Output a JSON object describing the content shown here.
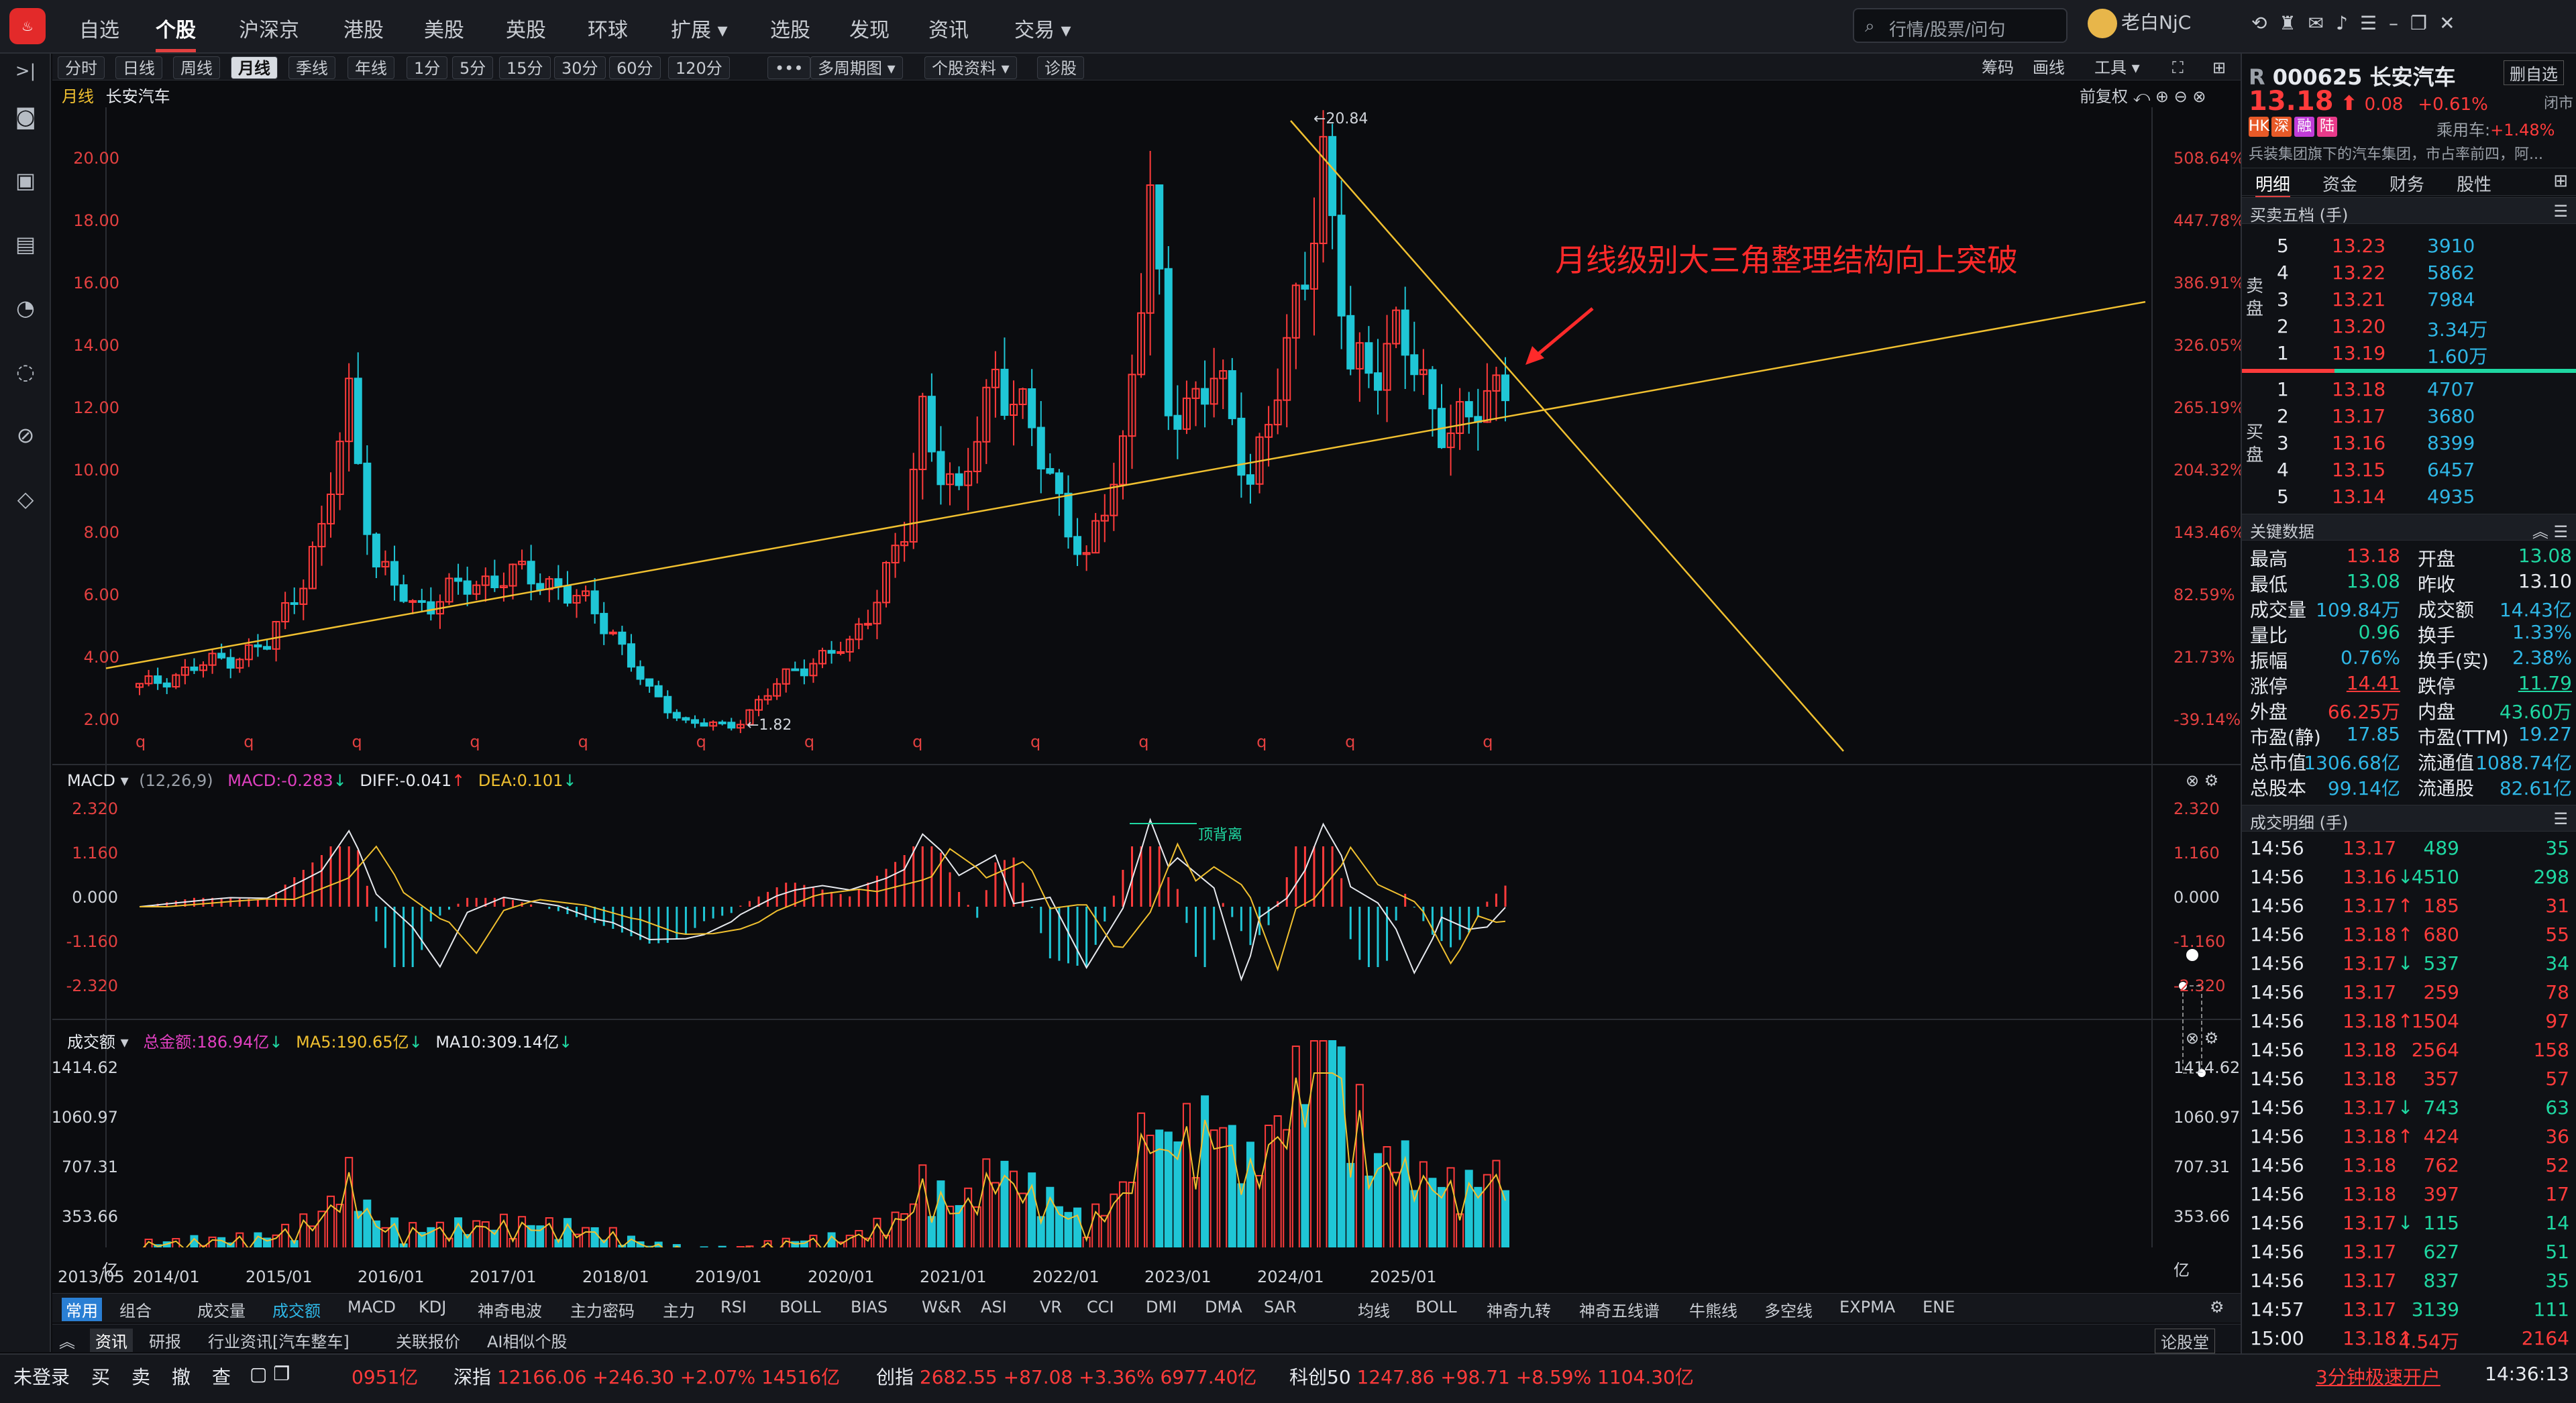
{
  "app": {
    "logo_text": "同花顺"
  },
  "nav": {
    "tabs": [
      "自选",
      "个股",
      "沪深京",
      "港股",
      "美股",
      "英股",
      "环球",
      "扩展",
      "选股",
      "发现",
      "资讯",
      "交易"
    ],
    "active": "个股",
    "search_placeholder": "行情/股票/问句",
    "user": "老白NjC"
  },
  "toolbar": {
    "periods": [
      "分时",
      "日线",
      "周线",
      "月线",
      "季线",
      "年线",
      "1分",
      "5分",
      "15分",
      "30分",
      "60分",
      "120分"
    ],
    "active_period": "月线",
    "more": "•••",
    "multi_cycle": "多周期图",
    "stock_info": "个股资料",
    "diagnose": "诊股",
    "right": [
      "筹码",
      "画线",
      "工具"
    ]
  },
  "chart_header": {
    "period": "月线",
    "name": "长安汽车",
    "restore": "前复权"
  },
  "annotation": "月线级别大三角整理结构向上突破",
  "price_marks": {
    "high": "←20.84",
    "low": "←1.82"
  },
  "macd_header": {
    "name": "MACD",
    "params": "(12,26,9)",
    "macd": "MACD:-0.283",
    "diff": "DIFF:-0.041",
    "dea": "DEA:0.101"
  },
  "macd_label": "顶背离",
  "vol_header": {
    "name": "成交额",
    "total": "总金额:186.94亿",
    "ma5": "MA5:190.65亿",
    "ma10": "MA10:309.14亿"
  },
  "x_axis": [
    "2013/05",
    "2014/01",
    "2015/01",
    "2016/01",
    "2017/01",
    "2018/01",
    "2019/01",
    "2020/01",
    "2021/01",
    "2022/01",
    "2023/01",
    "2024/01",
    "2025/01"
  ],
  "main_y_left": [
    "20.00",
    "18.00",
    "16.00",
    "14.00",
    "12.00",
    "10.00",
    "8.00",
    "6.00",
    "4.00",
    "2.00"
  ],
  "main_y_right": [
    "508.64%",
    "447.78%",
    "386.91%",
    "326.05%",
    "265.19%",
    "204.32%",
    "143.46%",
    "82.59%",
    "21.73%",
    "-39.14%"
  ],
  "macd_y": [
    "2.320",
    "1.160",
    "0.000",
    "-1.160",
    "-2.320"
  ],
  "vol_y": [
    "1414.62",
    "1060.97",
    "707.31",
    "353.66",
    "亿"
  ],
  "bottom_tabs": {
    "left": [
      "常用",
      "组合",
      "成交量",
      "成交额",
      "MACD",
      "KDJ",
      "神奇电波",
      "主力密码",
      "主力",
      "RSI",
      "BOLL",
      "BIAS",
      "W&R",
      "ASI",
      "VR",
      "CCI",
      "DMI",
      "DMA",
      "SAR"
    ],
    "active_left": [
      "常用",
      "成交额"
    ],
    "right": [
      "均线",
      "BOLL",
      "神奇九转",
      "神奇五线谱",
      "牛熊线",
      "多空线",
      "EXPMA",
      "ENE"
    ]
  },
  "info_tabs": [
    "资讯",
    "研报",
    "行业资讯[汽车整车]",
    "关联报价",
    "AI相似个股"
  ],
  "info_right": "论股堂",
  "stock": {
    "prefix": "R",
    "code": "000625",
    "name": "长安汽车",
    "price": "13.18",
    "change": "0.08",
    "pct": "+0.61%",
    "status": "闭市",
    "sector": "乘用车:",
    "sector_pct": "+1.48%",
    "desc": "兵装集团旗下的汽车集团，市占率前四，阿...",
    "tags": [
      "HK",
      "深",
      "融",
      "陆"
    ]
  },
  "panel_tabs": [
    "明细",
    "资金",
    "财务",
    "股性"
  ],
  "five_levels_title": "买卖五档 (手)",
  "sell_label": "卖盘",
  "buy_label": "买盘",
  "asks": [
    {
      "level": "5",
      "price": "13.23",
      "vol": "3910"
    },
    {
      "level": "4",
      "price": "13.22",
      "vol": "5862"
    },
    {
      "level": "3",
      "price": "13.21",
      "vol": "7984"
    },
    {
      "level": "2",
      "price": "13.20",
      "vol": "3.34万"
    },
    {
      "level": "1",
      "price": "13.19",
      "vol": "1.60万"
    }
  ],
  "bids": [
    {
      "level": "1",
      "price": "13.18",
      "vol": "4707"
    },
    {
      "level": "2",
      "price": "13.17",
      "vol": "3680"
    },
    {
      "level": "3",
      "price": "13.16",
      "vol": "8399"
    },
    {
      "level": "4",
      "price": "13.15",
      "vol": "6457"
    },
    {
      "level": "5",
      "price": "13.14",
      "vol": "4935"
    }
  ],
  "key_title": "关键数据",
  "key_data": [
    [
      "最高",
      "13.18",
      "red",
      "开盘",
      "13.08",
      "green"
    ],
    [
      "最低",
      "13.08",
      "green",
      "昨收",
      "13.10",
      "white"
    ],
    [
      "成交量",
      "109.84万",
      "cyan",
      "成交额",
      "14.43亿",
      "cyan"
    ],
    [
      "量比",
      "0.96",
      "green",
      "换手",
      "1.33%",
      "cyan"
    ],
    [
      "振幅",
      "0.76%",
      "cyan",
      "换手(实)",
      "2.38%",
      "cyan"
    ],
    [
      "涨停",
      "14.41",
      "red",
      "跌停",
      "11.79",
      "green"
    ],
    [
      "外盘",
      "66.25万",
      "red",
      "内盘",
      "43.60万",
      "green"
    ],
    [
      "市盈(静)",
      "17.85",
      "cyan",
      "市盈(TTM)",
      "19.27",
      "cyan"
    ],
    [
      "总市值",
      "1306.68亿",
      "cyan",
      "流通值",
      "1088.74亿",
      "cyan"
    ],
    [
      "总股本",
      "99.14亿",
      "cyan",
      "流通股",
      "82.61亿",
      "cyan"
    ]
  ],
  "trades_title": "成交明细 (手)",
  "trades": [
    [
      "14:56",
      "13.17",
      "",
      "489",
      "35",
      "green"
    ],
    [
      "14:56",
      "13.16",
      "↓",
      "4510",
      "298",
      "green"
    ],
    [
      "14:56",
      "13.17",
      "↑",
      "185",
      "31",
      "red"
    ],
    [
      "14:56",
      "13.18",
      "↑",
      "680",
      "55",
      "red"
    ],
    [
      "14:56",
      "13.17",
      "↓",
      "537",
      "34",
      "green"
    ],
    [
      "14:56",
      "13.17",
      "",
      "259",
      "78",
      "red"
    ],
    [
      "14:56",
      "13.18",
      "↑",
      "1504",
      "97",
      "red"
    ],
    [
      "14:56",
      "13.18",
      "",
      "2564",
      "158",
      "red"
    ],
    [
      "14:56",
      "13.18",
      "",
      "357",
      "57",
      "red"
    ],
    [
      "14:56",
      "13.17",
      "↓",
      "743",
      "63",
      "green"
    ],
    [
      "14:56",
      "13.18",
      "↑",
      "424",
      "36",
      "red"
    ],
    [
      "14:56",
      "13.18",
      "",
      "762",
      "52",
      "red"
    ],
    [
      "14:56",
      "13.18",
      "",
      "397",
      "17",
      "red"
    ],
    [
      "14:56",
      "13.17",
      "↓",
      "115",
      "14",
      "green"
    ],
    [
      "14:56",
      "13.17",
      "",
      "627",
      "51",
      "green"
    ],
    [
      "14:56",
      "13.17",
      "",
      "837",
      "35",
      "green"
    ],
    [
      "14:57",
      "13.17",
      "",
      "3139",
      "111",
      "green"
    ],
    [
      "15:00",
      "13.18",
      "↑",
      "4.54万",
      "2164",
      "red"
    ]
  ],
  "statusbar": {
    "login": "未登录",
    "quick": [
      "买",
      "卖",
      "撤",
      "查"
    ],
    "idx0_val": "0951亿",
    "idx1_name": "深指",
    "idx1_val": "12166.06",
    "idx1_chg": "+246.30",
    "idx1_pct": "+2.07%",
    "idx1_amt": "14516亿",
    "idx2_name": "创指",
    "idx2_val": "2682.55",
    "idx2_chg": "+87.08",
    "idx2_pct": "+3.36%",
    "idx2_amt": "6977.40亿",
    "idx3_name": "科创50",
    "idx3_val": "1247.86",
    "idx3_chg": "+98.71",
    "idx3_pct": "+8.59%",
    "idx3_amt": "1104.30亿",
    "promo": "3分钟极速开户",
    "clock": "14:36:13"
  },
  "colors": {
    "up": "#ff3b3b",
    "down": "#1fc6d6",
    "trend": "#f0c030",
    "accent": "#2fb7e6"
  }
}
